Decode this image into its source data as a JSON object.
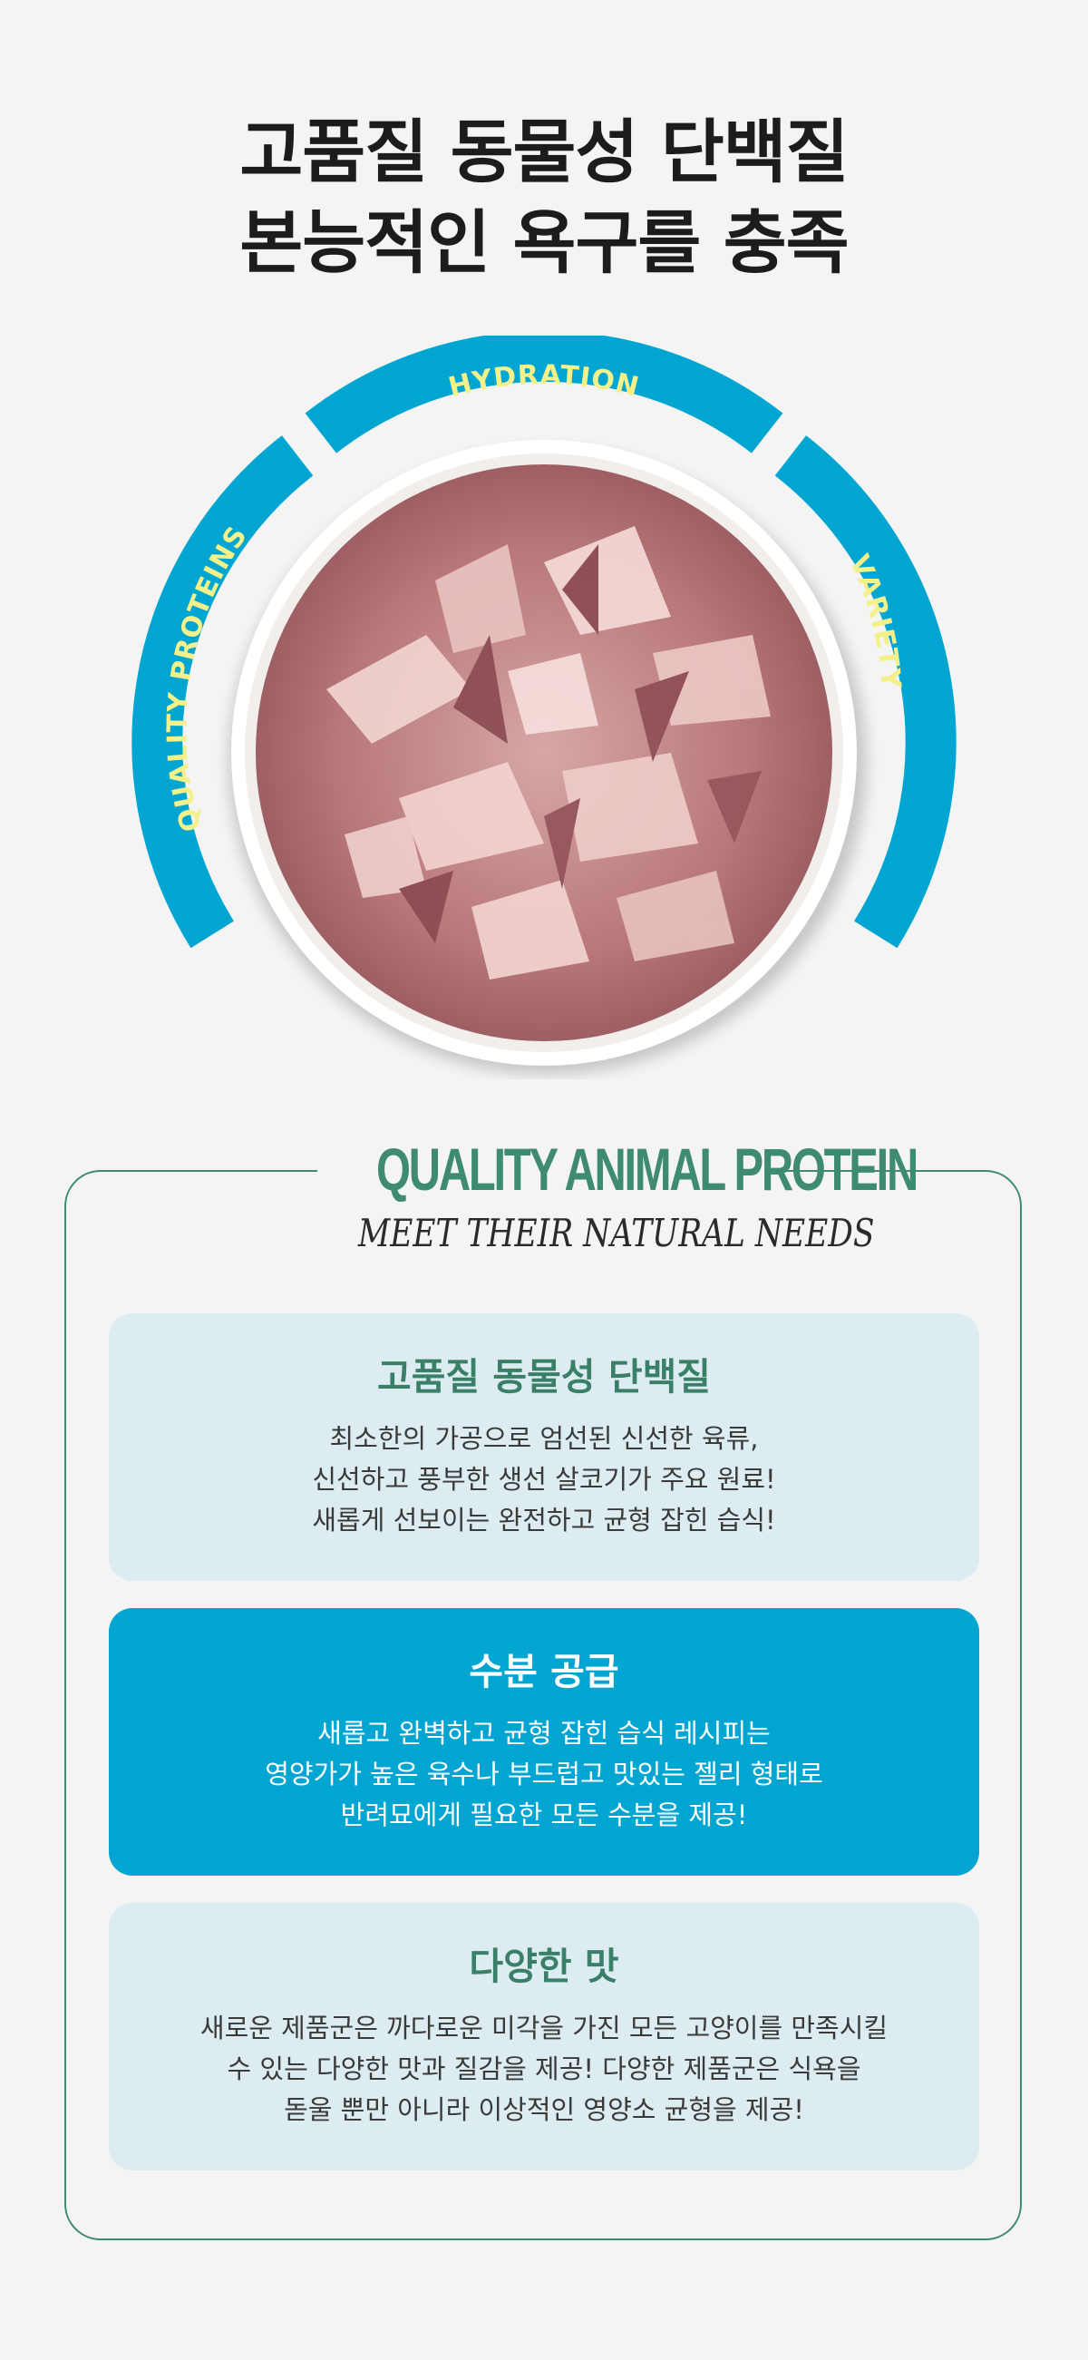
{
  "headline": {
    "line1": "고품질 동물성 단백질",
    "line2": "본능적인 욕구를 충족"
  },
  "hero": {
    "arc_labels": [
      "QUALITY PROTEINS",
      "HYDRATION",
      "VARIETY"
    ],
    "colors": {
      "arc": "#00a6d1",
      "label": "#f4f08a"
    }
  },
  "section": {
    "title": "QUALITY ANIMAL PROTEIN",
    "subtitle": "MEET THEIR NATURAL NEEDS"
  },
  "cards": [
    {
      "title": "고품질 동물성 단백질",
      "lines": [
        "최소한의 가공으로 엄선된 신선한 육류,",
        "신선하고 풍부한 생선 살코기가 주요 원료!",
        "새롭게 선보이는 완전하고 균형 잡힌 습식!"
      ]
    },
    {
      "title": "수분 공급",
      "lines": [
        "새롭고 완벽하고 균형 잡힌 습식 레시피는",
        "영양가가 높은 육수나 부드럽고 맛있는 젤리 형태로",
        "반려묘에게 필요한 모든 수분을 제공!"
      ]
    },
    {
      "title": "다양한 맛",
      "lines": [
        "새로운 제품군은 까다로운 미각을 가진 모든 고양이를 만족시킬",
        "수 있는 다양한 맛과 질감을 제공! 다양한 제품군은 식욕을",
        "돋울 뿐만 아니라 이상적인 영양소 균형을 제공!"
      ]
    }
  ]
}
